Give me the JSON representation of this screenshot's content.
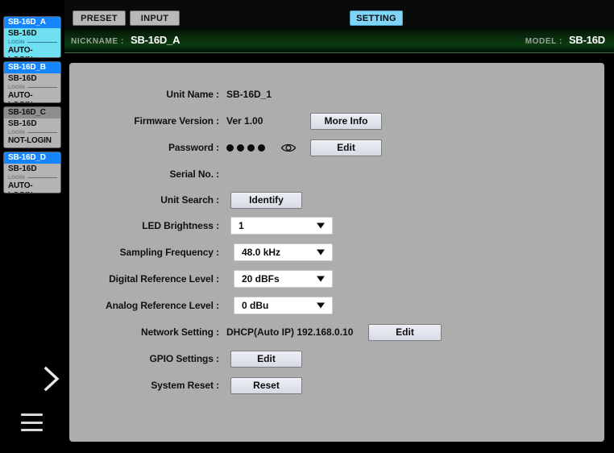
{
  "sidebar": {
    "units": [
      {
        "name": "SB-16D_A",
        "model": "SB-16D",
        "login_label": "LOGIN",
        "status": "AUTO-LOGIN",
        "selected": true,
        "head_blue": true
      },
      {
        "name": "SB-16D_B",
        "model": "SB-16D",
        "login_label": "LOGIN",
        "status": "AUTO-LOGIN",
        "selected": false,
        "head_blue": true
      },
      {
        "name": "SB-16D_C",
        "model": "SB-16D",
        "login_label": "LOGIN",
        "status": "NOT-LOGIN",
        "selected": false,
        "head_blue": false
      },
      {
        "name": "SB-16D_D",
        "model": "SB-16D",
        "login_label": "LOGIN",
        "status": "AUTO-LOGIN",
        "selected": false,
        "head_blue": true
      }
    ],
    "expand_icon": "chevron-right-icon",
    "menu_icon": "hamburger-menu-icon"
  },
  "topbar": {
    "tabs": [
      {
        "label": "PRESET",
        "active": false
      },
      {
        "label": "INPUT",
        "active": false
      },
      {
        "label": "SETTING",
        "active": true
      }
    ],
    "nickname_label": "NICKNAME :",
    "nickname_value": "SB-16D_A",
    "model_label": "MODEL :",
    "model_value": "SB-16D"
  },
  "settings": {
    "unit_name": {
      "label": "Unit Name :",
      "value": "SB-16D_1"
    },
    "firmware": {
      "label": "Firmware Version :",
      "value": "Ver 1.00",
      "button": "More Info"
    },
    "password": {
      "label": "Password :",
      "dots": 4,
      "eye_icon": "eye-icon",
      "button": "Edit"
    },
    "serial": {
      "label": "Serial No. :",
      "value": ""
    },
    "unit_search": {
      "label": "Unit Search :",
      "button": "Identify"
    },
    "led_brightness": {
      "label": "LED Brightness :",
      "value": "1"
    },
    "sampling_frequency": {
      "label": "Sampling Frequency :",
      "value": "48.0 kHz"
    },
    "digital_ref_level": {
      "label": "Digital Reference Level :",
      "value": "20 dBFs"
    },
    "analog_ref_level": {
      "label": "Analog Reference Level :",
      "value": "0 dBu"
    },
    "network": {
      "label": "Network Setting :",
      "value": "DHCP(Auto IP)  192.168.0.10",
      "button": "Edit"
    },
    "gpio": {
      "label": "GPIO Settings :",
      "button": "Edit"
    },
    "system_reset": {
      "label": "System Reset :",
      "button": "Reset"
    }
  },
  "colors": {
    "accent_blue": "#1585ff",
    "selected_cyan": "#6fe0f2",
    "tab_active": "#7fd4f7",
    "panel_gray": "#adadad",
    "infobar_green": "#0b3b10"
  }
}
